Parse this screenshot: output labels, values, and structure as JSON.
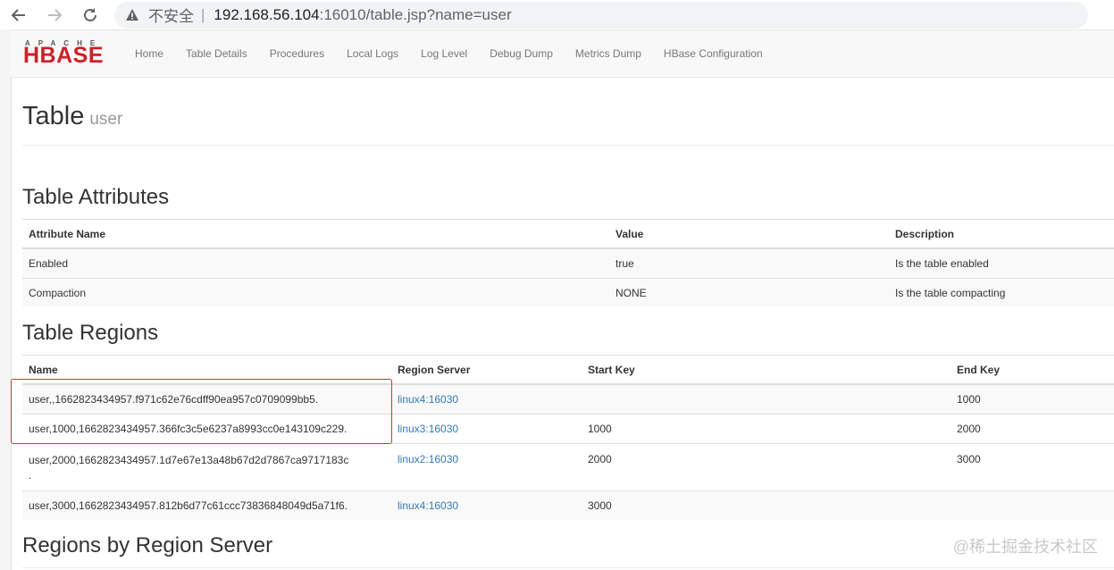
{
  "browser": {
    "insecure_label": "不安全",
    "separator": "|",
    "url_host": "192.168.56.104",
    "url_path": ":16010/table.jsp?name=user"
  },
  "navbar": {
    "logo_top": "APACHE",
    "logo_main": "HBASE",
    "items": [
      "Home",
      "Table Details",
      "Procedures",
      "Local Logs",
      "Log Level",
      "Debug Dump",
      "Metrics Dump",
      "HBase Configuration"
    ]
  },
  "page": {
    "title": "Table",
    "subtitle": "user"
  },
  "attributes": {
    "heading": "Table Attributes",
    "columns": [
      "Attribute Name",
      "Value",
      "Description"
    ],
    "rows": [
      [
        "Enabled",
        "true",
        "Is the table enabled"
      ],
      [
        "Compaction",
        "NONE",
        "Is the table compacting"
      ]
    ]
  },
  "regions": {
    "heading": "Table Regions",
    "columns": [
      "Name",
      "Region Server",
      "Start Key",
      "End Key"
    ],
    "rows": [
      {
        "name": "user,,1662823434957.f971c62e76cdff90ea957c0709099bb5.",
        "server": "linux4:16030",
        "start": "",
        "end": "1000"
      },
      {
        "name": "user,1000,1662823434957.366fc3c5e6237a8993cc0e143109c229.",
        "server": "linux3:16030",
        "start": "1000",
        "end": "2000"
      },
      {
        "name": "user,2000,1662823434957.1d7e67e13a48b67d2d7867ca9717183c",
        "name_wrap": ".",
        "server": "linux2:16030",
        "start": "2000",
        "end": "3000"
      },
      {
        "name": "user,3000,1662823434957.812b6d77c61ccc73836848049d5a71f6.",
        "server": "linux4:16030",
        "start": "3000",
        "end": ""
      }
    ]
  },
  "regions_by_server": {
    "heading": "Regions by Region Server"
  },
  "watermark": "@稀土掘金技术社区"
}
